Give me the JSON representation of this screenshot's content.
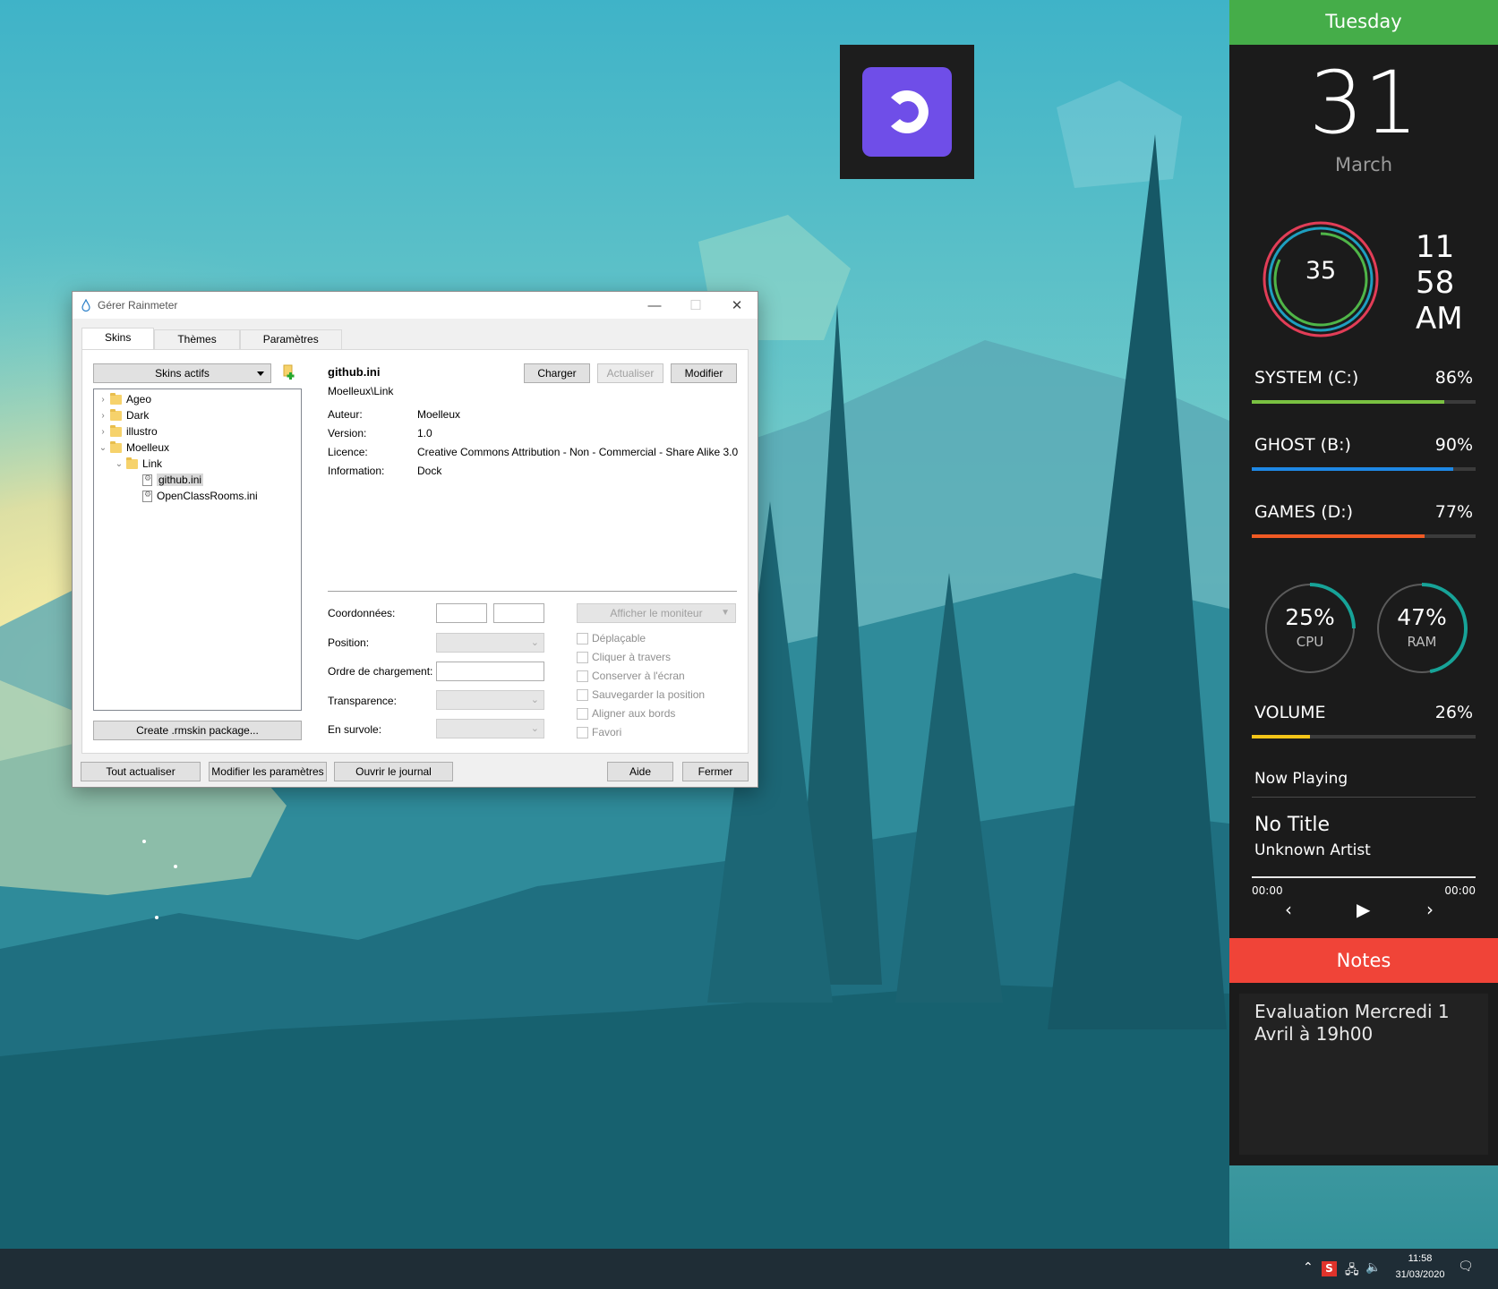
{
  "dialog": {
    "title": "Gérer Rainmeter",
    "tabs": [
      "Skins",
      "Thèmes",
      "Paramètres"
    ],
    "skin_dropdown": "Skins actifs",
    "tree": [
      {
        "label": "Ageo",
        "type": "folder",
        "state": "collapsed"
      },
      {
        "label": "Dark",
        "type": "folder",
        "state": "collapsed"
      },
      {
        "label": "illustro",
        "type": "folder",
        "state": "collapsed"
      },
      {
        "label": "Moelleux",
        "type": "folder",
        "state": "expanded"
      },
      {
        "label": "Link",
        "type": "folder",
        "state": "expanded"
      },
      {
        "label": "github.ini",
        "type": "file",
        "selected": true
      },
      {
        "label": "OpenClassRooms.ini",
        "type": "file"
      }
    ],
    "create_package": "Create .rmskin package...",
    "skin": {
      "name": "github.ini",
      "path": "Moelleux\\Link",
      "author_label": "Auteur:",
      "author": "Moelleux",
      "version_label": "Version:",
      "version": "1.0",
      "license_label": "Licence:",
      "license": "Creative Commons Attribution - Non - Commercial - Share Alike 3.0",
      "info_label": "Information:",
      "info": "Dock"
    },
    "actions": {
      "load": "Charger",
      "refresh": "Actualiser",
      "edit": "Modifier"
    },
    "fields": {
      "coords": "Coordonnées:",
      "position": "Position:",
      "load_order": "Ordre de chargement:",
      "transparency": "Transparence:",
      "on_hover": "En survole:"
    },
    "monitor_button": "Afficher le moniteur",
    "checkboxes": [
      "Déplaçable",
      "Cliquer à travers",
      "Conserver à l'écran",
      "Sauvegarder la position",
      "Aligner aux bords",
      "Favori"
    ],
    "bottom": {
      "refresh_all": "Tout actualiser",
      "edit_settings": "Modifier les paramètres",
      "open_log": "Ouvrir le journal",
      "help": "Aide",
      "close": "Fermer"
    }
  },
  "sidebar": {
    "day": "Tuesday",
    "date": "31",
    "month": "March",
    "seconds": "35",
    "hour": "11",
    "minute": "58",
    "ampm": "AM",
    "drives": [
      {
        "label": "SYSTEM (C:)",
        "percent": "86%",
        "fraction": 0.86,
        "color": "#7ac142"
      },
      {
        "label": "GHOST (B:)",
        "percent": "90%",
        "fraction": 0.9,
        "color": "#1e88e5"
      },
      {
        "label": "GAMES (D:)",
        "percent": "77%",
        "fraction": 0.77,
        "color": "#f15a24"
      }
    ],
    "cpu": {
      "percent": "25%",
      "label": "CPU",
      "fraction": 0.25
    },
    "ram": {
      "percent": "47%",
      "label": "RAM",
      "fraction": 0.47
    },
    "volume": {
      "label": "VOLUME",
      "percent": "26%",
      "fraction": 0.26,
      "color": "#f5c518"
    },
    "now_playing": {
      "label": "Now Playing",
      "title": "No Title",
      "artist": "Unknown Artist",
      "elapsed": "00:00",
      "total": "00:00"
    },
    "notes": {
      "header": "Notes",
      "text": "Evaluation Mercredi 1 Avril à 19h00"
    },
    "colors": {
      "day_header": "#45ad49",
      "notes_header": "#f04438",
      "gauge": "#17a398"
    }
  },
  "taskbar": {
    "time": "11:58",
    "date": "31/03/2020"
  }
}
